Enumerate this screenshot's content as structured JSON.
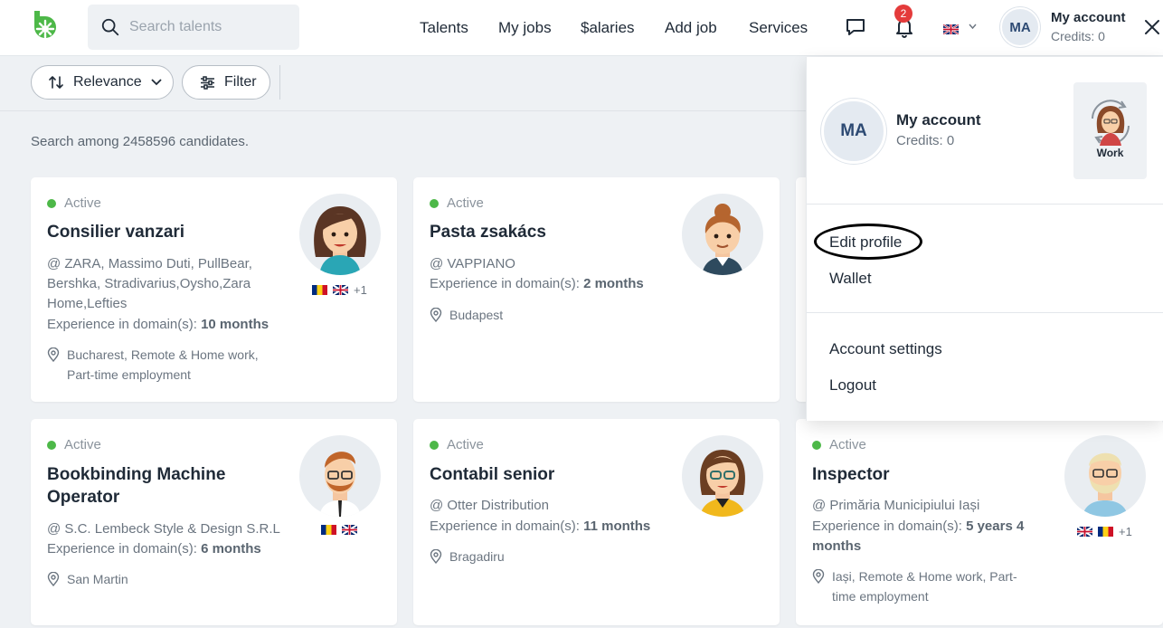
{
  "header": {
    "search_placeholder": "Search talents",
    "nav": [
      "Talents",
      "My jobs",
      "$alaries",
      "Add job",
      "Services"
    ],
    "notification_count": "2",
    "avatar_initials": "MA",
    "account_title": "My account",
    "account_credits": "Credits: 0"
  },
  "toolbar": {
    "sort_label": "Relevance",
    "filter_label": "Filter"
  },
  "search_count": "Search among 2458596 candidates.",
  "cards": [
    {
      "status": "Active",
      "title": "Consilier vanzari",
      "company_lines": [
        "@ ZARA, Massimo Duti, PullBear,",
        "Bershka, Stradivarius,Oysho,Zara",
        "Home,Lefties"
      ],
      "experience_label": "Experience in domain(s): ",
      "experience_value": "10 months",
      "location_lines": [
        "Bucharest, Remote & Home work,",
        "Part-time employment"
      ],
      "flags_extra": "+1"
    },
    {
      "status": "Active",
      "title": "Pasta zsakács",
      "company_lines": [
        "@ VAPPIANO"
      ],
      "experience_label": "Experience in domain(s): ",
      "experience_value": "2 months",
      "location_lines": [
        "Budapest"
      ]
    },
    {
      "status": "Active",
      "title_lines": [
        "Bookbinding Machine",
        "Operator"
      ],
      "company_lines": [
        "@ S.C. Lembeck Style & Design S.R.L"
      ],
      "experience_label": "Experience in domain(s): ",
      "experience_value": "6 months",
      "location_lines": [
        "San Martin"
      ]
    },
    {
      "status": "Active",
      "title": "Contabil senior",
      "company_lines": [
        "@ Otter Distribution"
      ],
      "experience_label": "Experience in domain(s): ",
      "experience_value": "11 months",
      "location_lines": [
        "Bragadiru"
      ]
    },
    {
      "status": "Active",
      "title": "Inspector",
      "company_lines": [
        "@ Primăria Municipiului Iași"
      ],
      "experience_label": "Experience in domain(s): ",
      "experience_value_lines": [
        "5 years 4",
        "months"
      ],
      "location_lines": [
        "Iași, Remote & Home work, Part-",
        "time employment"
      ],
      "flags_extra": "+1"
    }
  ],
  "dropdown": {
    "avatar_initials": "MA",
    "title": "My account",
    "credits": "Credits: 0",
    "work_label": "Work",
    "items": [
      "Edit profile",
      "Wallet",
      "Account settings",
      "Logout"
    ]
  },
  "colors": {
    "brand_green": "#4db848",
    "badge_red": "#e43b3b",
    "page_bg": "#eef1f4"
  }
}
